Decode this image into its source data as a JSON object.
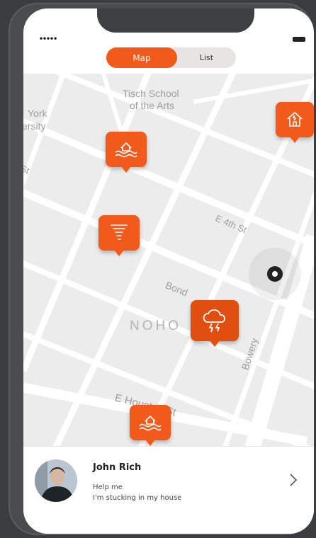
{
  "status_bar": {
    "signal_icon": "signal-dots-icon",
    "battery_icon": "battery-icon"
  },
  "view_toggle": {
    "map_label": "Map",
    "list_label": "List",
    "selected": "Map",
    "accent_color": "#f15a1b"
  },
  "map": {
    "place_labels": {
      "tisch_line1": "Tisch School",
      "tisch_line2": "of the Arts",
      "york_line1": "York",
      "york_line2": "ersity",
      "e4th": "E 4th St",
      "bond": "Bond",
      "noho": "NOHO",
      "bowery": "Bowery",
      "ehouston": "E Houston St",
      "st_partial": "St"
    },
    "markers": [
      {
        "icon": "flood-icon"
      },
      {
        "icon": "earthquake-house-icon"
      },
      {
        "icon": "tornado-icon"
      },
      {
        "icon": "storm-icon"
      },
      {
        "icon": "flood-icon"
      }
    ],
    "current_location_icon": "location-dot-icon"
  },
  "request_card": {
    "name": "John Rich",
    "message_line1": "Help me",
    "message_line2": "I'm stucking in my house",
    "chevron_icon": "chevron-right-icon"
  }
}
